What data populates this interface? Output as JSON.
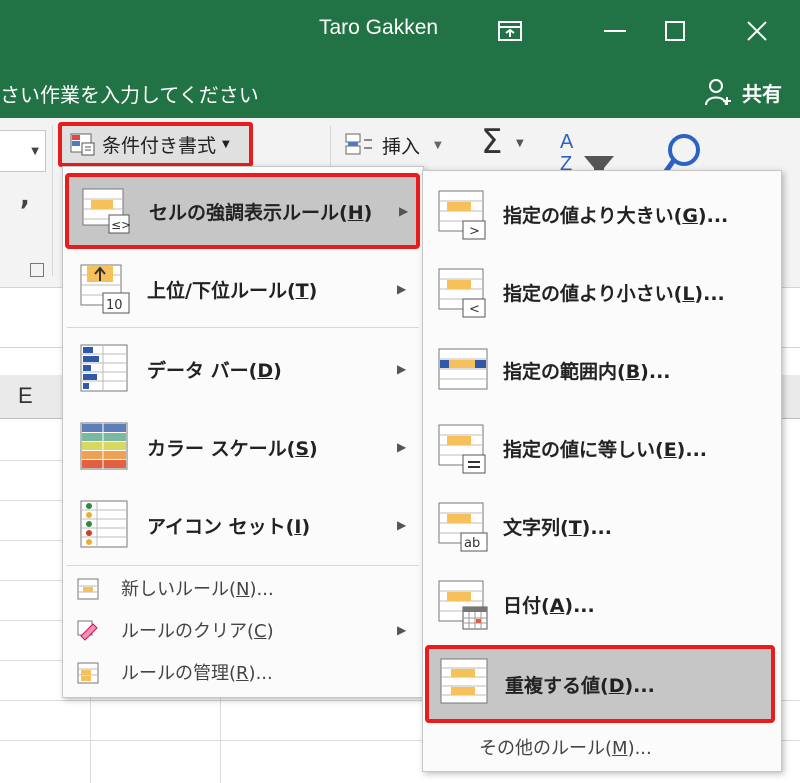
{
  "titlebar": {
    "user": "Taro Gakken",
    "bg_color": "#217346"
  },
  "tellbar": {
    "tell_text": "さい作業を入力してください",
    "share_label": "共有"
  },
  "ribbon": {
    "conditional_format_label": "条件付き書式",
    "insert_label": "挿入",
    "column_header": "E"
  },
  "menu1": {
    "items": [
      {
        "label": "セルの強調表示ルール(",
        "key": "H",
        "suffix": ")",
        "icon": "highlight-cells-icon",
        "submenu": true,
        "highlighted": true
      },
      {
        "label": "上位/下位ルール(",
        "key": "T",
        "suffix": ")",
        "icon": "top-bottom-icon",
        "submenu": true
      },
      {
        "label": "データ バー(",
        "key": "D",
        "suffix": ")",
        "icon": "data-bars-icon",
        "submenu": true
      },
      {
        "label": "カラー スケール(",
        "key": "S",
        "suffix": ")",
        "icon": "color-scales-icon",
        "submenu": true
      },
      {
        "label": "アイコン セット(",
        "key": "I",
        "suffix": ")",
        "icon": "icon-sets-icon",
        "submenu": true
      }
    ],
    "small_items": [
      {
        "label": "新しいルール(",
        "key": "N",
        "suffix": ")...",
        "icon": "new-rule-icon"
      },
      {
        "label": "ルールのクリア(",
        "key": "C",
        "suffix": ")",
        "icon": "clear-rules-icon",
        "submenu": true
      },
      {
        "label": "ルールの管理(",
        "key": "R",
        "suffix": ")...",
        "icon": "manage-rules-icon"
      }
    ]
  },
  "menu2": {
    "items": [
      {
        "label": "指定の値より大きい(",
        "key": "G",
        "suffix": ")...",
        "icon": "greater-than-icon"
      },
      {
        "label": "指定の値より小さい(",
        "key": "L",
        "suffix": ")...",
        "icon": "less-than-icon"
      },
      {
        "label": "指定の範囲内(",
        "key": "B",
        "suffix": ")...",
        "icon": "between-icon"
      },
      {
        "label": "指定の値に等しい(",
        "key": "E",
        "suffix": ")...",
        "icon": "equal-to-icon"
      },
      {
        "label": "文字列(",
        "key": "T",
        "suffix": ")...",
        "icon": "text-contains-icon"
      },
      {
        "label": "日付(",
        "key": "A",
        "suffix": ")...",
        "icon": "date-occurring-icon"
      },
      {
        "label": "重複する値(",
        "key": "D",
        "suffix": ")...",
        "icon": "duplicate-values-icon",
        "highlighted": true
      }
    ],
    "more": {
      "label": "その他のルール(",
      "key": "M",
      "suffix": ")..."
    }
  },
  "colors": {
    "accent_red": "#e81c1c",
    "highlight_gray": "#c6c6c6",
    "excel_green": "#217346"
  }
}
